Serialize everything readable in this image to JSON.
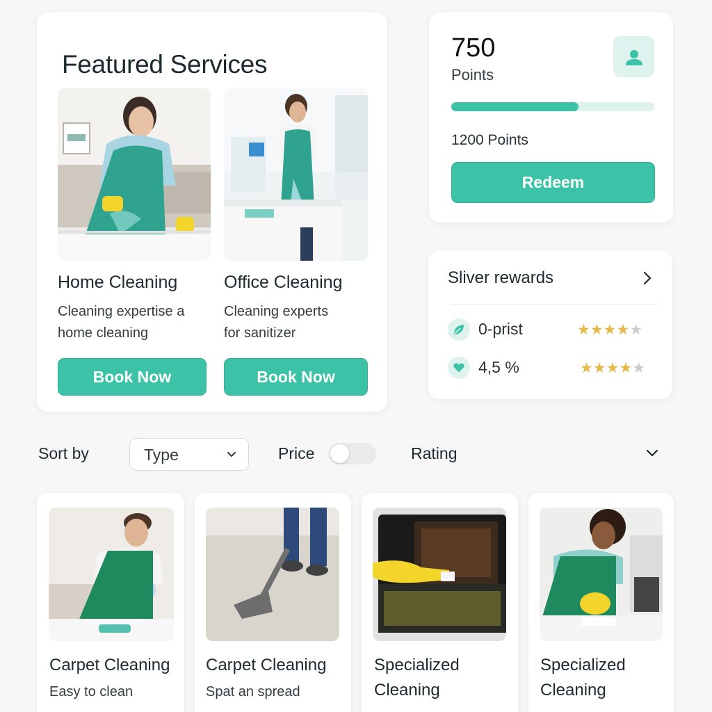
{
  "featured": {
    "title": "Featured Services",
    "services": [
      {
        "name": "Home Cleaning",
        "desc_line1": "Cleaning expertise a",
        "desc_line2": "home cleaning",
        "button": "Book Now"
      },
      {
        "name": "Office Cleaning",
        "desc_line1": "Cleaning experts",
        "desc_line2": "for sanitizer",
        "button": "Book Now"
      }
    ]
  },
  "points": {
    "value": "750",
    "label": "Points",
    "progress_fraction": 0.625,
    "goal": "1200 Points",
    "redeem": "Redeem",
    "icon": "user-icon"
  },
  "rewards": {
    "title": "Sliver rewards",
    "items": [
      {
        "label": "0-prist",
        "icon": "leaf-icon",
        "rating": 4.5
      },
      {
        "label": "4,5 %",
        "icon": "heart-icon",
        "rating": 4
      }
    ]
  },
  "sort": {
    "label": "Sort by",
    "type_value": "Type",
    "price_label": "Price",
    "price_toggle_on": false,
    "rating_label": "Rating"
  },
  "listings": [
    {
      "name": "Carpet Cleaning",
      "sub": "Easy to clean"
    },
    {
      "name": "Carpet Cleaning",
      "sub": "Spat an spread"
    },
    {
      "name_line1": "Specialized",
      "name_line2": "Cleaning"
    },
    {
      "name_line1": "Specialized",
      "name_line2": "Cleaning"
    }
  ],
  "colors": {
    "accent": "#3cc3a7",
    "accent_light": "#dff3ee",
    "star": "#e7b84a"
  }
}
